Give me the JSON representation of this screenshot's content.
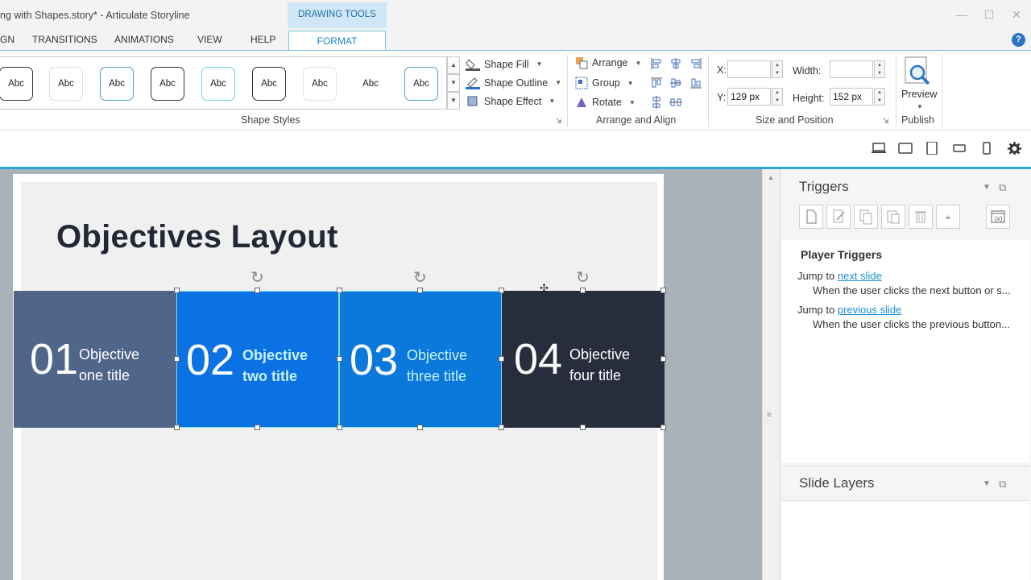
{
  "window": {
    "title": "ng with Shapes.story* -  Articulate Storyline",
    "context_tab_group": "DRAWING TOOLS"
  },
  "tabs": [
    "GN",
    "TRANSITIONS",
    "ANIMATIONS",
    "VIEW",
    "HELP"
  ],
  "active_tab": "FORMAT",
  "help_label": "?",
  "ribbon": {
    "shape_styles": {
      "swatch_label": "Abc",
      "group_label": "Shape Styles",
      "fill": "Shape Fill",
      "outline": "Shape Outline",
      "effect": "Shape Effect"
    },
    "arrange": {
      "arrange": "Arrange",
      "group": "Group",
      "rotate": "Rotate",
      "group_label": "Arrange and Align"
    },
    "size_position": {
      "x_label": "X:",
      "x_value": "",
      "y_label": "Y:",
      "y_value": "129 px",
      "width_label": "Width:",
      "width_value": "",
      "height_label": "Height:",
      "height_value": "152 px",
      "group_label": "Size and Position"
    },
    "preview": {
      "label": "Preview",
      "group_label": "Publish"
    }
  },
  "slide": {
    "title": "Objectives Layout",
    "objectives": [
      {
        "number": "01",
        "line1": "Objective",
        "line2": "one title",
        "color": "#50658a",
        "text_color": "#ffffff"
      },
      {
        "number": "02",
        "line1": "Objective",
        "line2": "two title",
        "color": "#0a72e3",
        "text_color": "#c6f3ff"
      },
      {
        "number": "03",
        "line1": "Objective",
        "line2": "three title",
        "color": "#0b78dc",
        "text_color": "#c6f3ff"
      },
      {
        "number": "04",
        "line1": "Objective",
        "line2": "four title",
        "color": "#272d3c",
        "text_color": "#ffffff"
      }
    ]
  },
  "triggers_panel": {
    "title": "Triggers",
    "section": "Player Triggers",
    "items": [
      {
        "action": "Jump to",
        "target": "next slide",
        "condition": "When the user clicks the next button or s..."
      },
      {
        "action": "Jump to",
        "target": "previous slide",
        "condition": "When the user clicks the previous button..."
      }
    ]
  },
  "layers_panel": {
    "title": "Slide Layers"
  },
  "colors": {
    "accent": "#2aa7d9",
    "link": "#1a8fd4"
  }
}
